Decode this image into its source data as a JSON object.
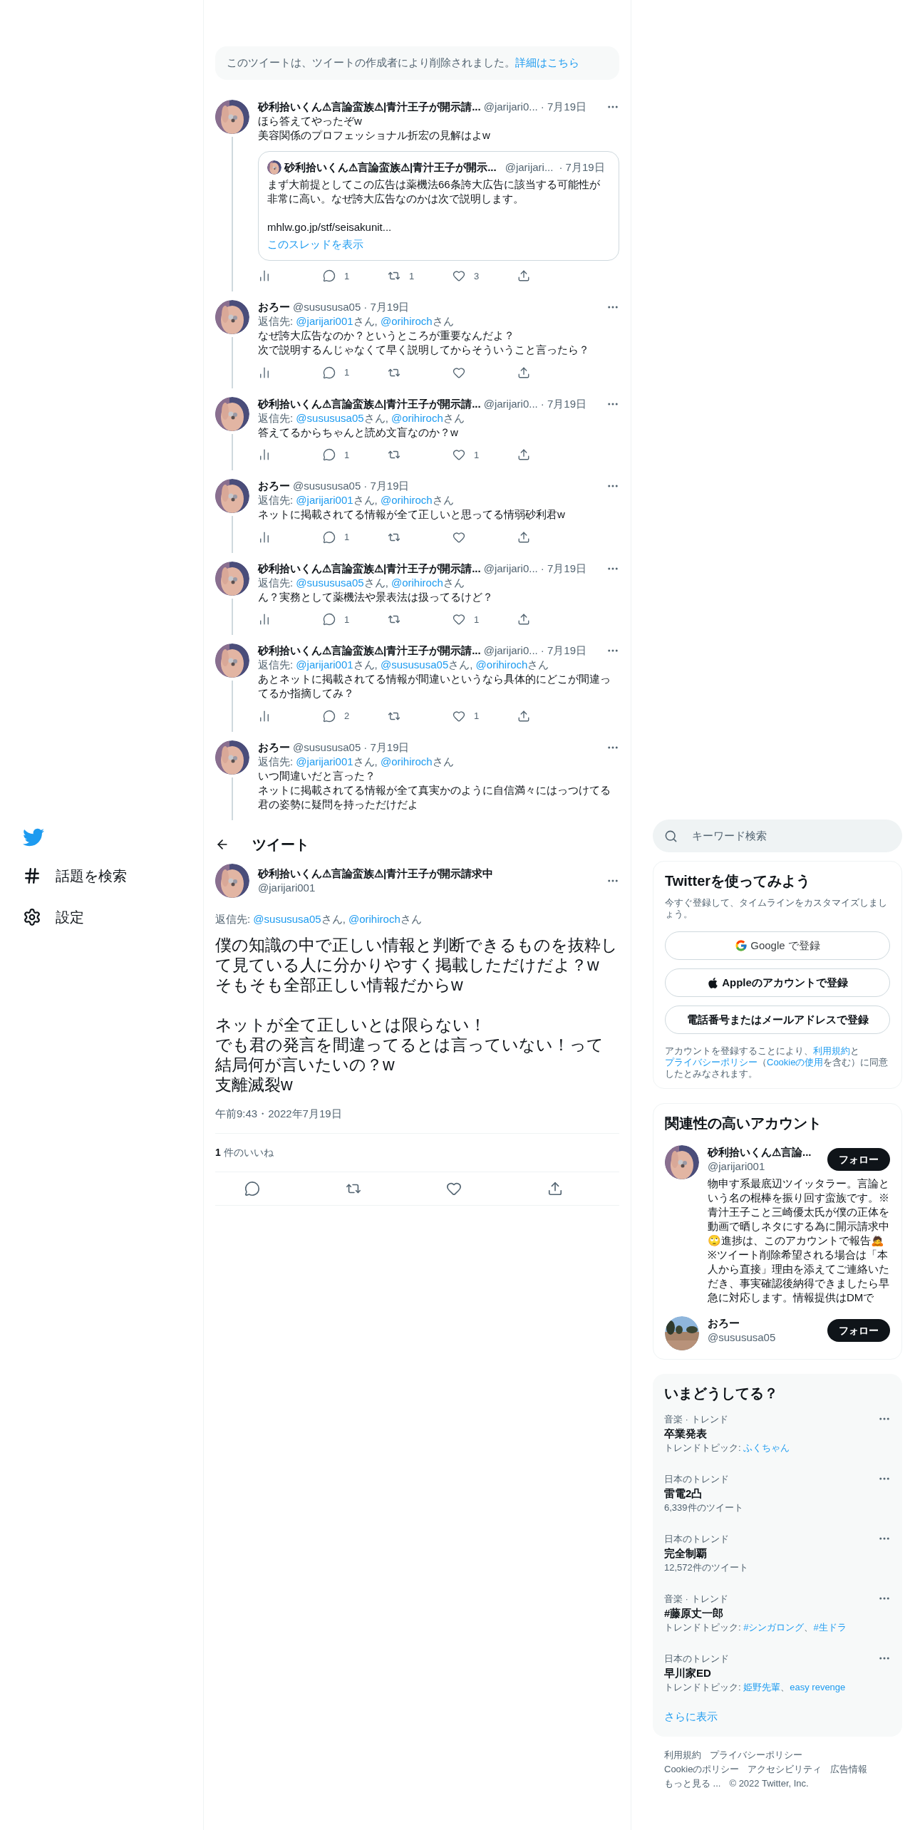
{
  "deleted_notice": {
    "text": "このツイートは、ツイートの作成者により削除されました。",
    "link": "詳細はこちら"
  },
  "thread": [
    {
      "name": "砂利拾いくん⚠言論蛮族⚠|青汁王子が開示請...",
      "handle": "@jarijari0...",
      "date": "· 7月19日",
      "lines": [
        "ほら答えてやったぞw",
        "美容関係のプロフェッショナル折宏の見解はよw"
      ],
      "quote": {
        "name": "砂利拾いくん⚠言論蛮族⚠|青汁王子が開示...",
        "handle": "@jarijari...",
        "date": "· 7月19日",
        "text": "まず大前提としてこの広告は薬機法66条誇大広告に該当する可能性が非常に高い。なぜ誇大広告なのかは次で説明します。",
        "url": "mhlw.go.jp/stf/seisakunit...",
        "thread_link": "このスレッドを表示"
      },
      "actions": [
        {
          "kind": "views"
        },
        {
          "kind": "reply",
          "count": "1"
        },
        {
          "kind": "retweet",
          "count": "1"
        },
        {
          "kind": "like",
          "count": "3"
        },
        {
          "kind": "share"
        }
      ]
    },
    {
      "name": "おろー",
      "handle": "@susususa05",
      "date": "· 7月19日",
      "reply_to": {
        "label": "返信先:",
        "separator": ", ",
        "mentions": [
          {
            "handle": "@jarijari001",
            "honorific": "さん"
          },
          {
            "handle": "@orihiroch",
            "honorific": "さん"
          }
        ]
      },
      "lines": [
        "なぜ誇大広告なのか？というところが重要なんだよ？",
        "次で説明するんじゃなくて早く説明してからそういうこと言ったら？"
      ],
      "actions": [
        {
          "kind": "views"
        },
        {
          "kind": "reply",
          "count": "1"
        },
        {
          "kind": "retweet"
        },
        {
          "kind": "like"
        },
        {
          "kind": "share"
        }
      ]
    },
    {
      "name": "砂利拾いくん⚠言論蛮族⚠|青汁王子が開示請...",
      "handle": "@jarijari0...",
      "date": "· 7月19日",
      "reply_to": {
        "label": "返信先:",
        "separator": ", ",
        "mentions": [
          {
            "handle": "@susususa05",
            "honorific": "さん"
          },
          {
            "handle": "@orihiroch",
            "honorific": "さん"
          }
        ]
      },
      "lines": [
        "答えてるからちゃんと読め文盲なのか？w"
      ],
      "actions": [
        {
          "kind": "views"
        },
        {
          "kind": "reply",
          "count": "1"
        },
        {
          "kind": "retweet"
        },
        {
          "kind": "like",
          "count": "1"
        },
        {
          "kind": "share"
        }
      ]
    },
    {
      "name": "おろー",
      "handle": "@susususa05",
      "date": "· 7月19日",
      "reply_to": {
        "label": "返信先:",
        "separator": ", ",
        "mentions": [
          {
            "handle": "@jarijari001",
            "honorific": "さん"
          },
          {
            "handle": "@orihiroch",
            "honorific": "さん"
          }
        ]
      },
      "lines": [
        "ネットに掲載されてる情報が全て正しいと思ってる情弱砂利君w"
      ],
      "actions": [
        {
          "kind": "views"
        },
        {
          "kind": "reply",
          "count": "1"
        },
        {
          "kind": "retweet"
        },
        {
          "kind": "like"
        },
        {
          "kind": "share"
        }
      ]
    },
    {
      "name": "砂利拾いくん⚠言論蛮族⚠|青汁王子が開示請...",
      "handle": "@jarijari0...",
      "date": "· 7月19日",
      "reply_to": {
        "label": "返信先:",
        "separator": ", ",
        "mentions": [
          {
            "handle": "@susususa05",
            "honorific": "さん"
          },
          {
            "handle": "@orihiroch",
            "honorific": "さん"
          }
        ]
      },
      "lines": [
        "ん？実務として薬機法や景表法は扱ってるけど？"
      ],
      "actions": [
        {
          "kind": "views"
        },
        {
          "kind": "reply",
          "count": "1"
        },
        {
          "kind": "retweet"
        },
        {
          "kind": "like",
          "count": "1"
        },
        {
          "kind": "share"
        }
      ]
    },
    {
      "name": "砂利拾いくん⚠言論蛮族⚠|青汁王子が開示請...",
      "handle": "@jarijari0...",
      "date": "· 7月19日",
      "reply_to": {
        "label": "返信先:",
        "separator": ", ",
        "mentions": [
          {
            "handle": "@jarijari001",
            "honorific": "さん"
          },
          {
            "handle": "@susususa05",
            "honorific": "さん"
          },
          {
            "handle": "@orihiroch",
            "honorific": "さん"
          }
        ]
      },
      "lines": [
        "あとネットに掲載されてる情報が間違いというなら具体的にどこが間違ってるか指摘してみ？"
      ],
      "actions": [
        {
          "kind": "views"
        },
        {
          "kind": "reply",
          "count": "2"
        },
        {
          "kind": "retweet"
        },
        {
          "kind": "like",
          "count": "1"
        },
        {
          "kind": "share"
        }
      ]
    },
    {
      "name": "おろー",
      "handle": "@susususa05",
      "date": "· 7月19日",
      "reply_to": {
        "label": "返信先:",
        "separator": ", ",
        "mentions": [
          {
            "handle": "@jarijari001",
            "honorific": "さん"
          },
          {
            "handle": "@orihiroch",
            "honorific": "さん"
          }
        ]
      },
      "lines": [
        "いつ間違いだと言った？",
        "ネットに掲載されてる情報が全て真実かのように自信満々にはっつけてる",
        "君の姿勢に疑問を持っただけだよ"
      ]
    }
  ],
  "header": {
    "title": "ツイート"
  },
  "main_tweet": {
    "name": "砂利拾いくん⚠言論蛮族⚠|青汁王子が開示請求中",
    "handle": "@jarijari001",
    "reply_to": {
      "label": "返信先:",
      "separator": ", ",
      "mentions": [
        {
          "handle": "@susususa05",
          "honorific": "さん"
        },
        {
          "handle": "@orihiroch",
          "honorific": "さん"
        }
      ]
    },
    "paragraphs": [
      [
        "僕の知識の中で正しい情報と判断できるものを抜粋して見ている人に分かりやすく掲載しただけだよ？w",
        "そもそも全部正しい情報だからw"
      ],
      [
        "ネットが全て正しいとは限らない！",
        "でも君の発言を間違ってるとは言っていない！って",
        "結局何が言いたいの？w",
        "支離滅裂w"
      ]
    ],
    "timestamp": "午前9:43・2022年7月19日",
    "likes": {
      "count": "1",
      "label": "件のいいね"
    },
    "actions": [
      {
        "kind": "reply"
      },
      {
        "kind": "retweet"
      },
      {
        "kind": "like"
      },
      {
        "kind": "share"
      }
    ]
  },
  "sidebar_nav": [
    {
      "kind": "hash",
      "label": "話題を検索"
    },
    {
      "kind": "gear",
      "label": "設定"
    }
  ],
  "search": {
    "placeholder": "キーワード検索"
  },
  "signup": {
    "title": "Twitterを使ってみよう",
    "description": "今すぐ登録して、タイムラインをカスタマイズしましょう。",
    "buttons": [
      {
        "kind": "google",
        "label": "Google で登録"
      },
      {
        "kind": "apple",
        "label": "Appleのアカウントで登録"
      },
      {
        "kind": "plain",
        "label": "電話番号またはメールアドレスで登録"
      }
    ],
    "legal": [
      {
        "text": "アカウントを登録することにより、",
        "link": false
      },
      {
        "text": "利用規約",
        "link": true
      },
      {
        "text": "と",
        "link": false
      },
      {
        "text": "プライバシーポリシー",
        "link": true
      },
      {
        "text": "（",
        "link": false
      },
      {
        "text": "Cookieの使用",
        "link": true
      },
      {
        "text": "を含む）に同意したとみなされます。",
        "link": false
      }
    ]
  },
  "related": {
    "title": "関連性の高いアカウント",
    "accounts": [
      {
        "name": "砂利拾いくん⚠言論...",
        "handle": "@jarijari001",
        "follow": "フォロー",
        "bio": "物申す系最底辺ツイッタラー。言論という名の棍棒を振り回す蛮族です。※青汁王子こと三崎優太氏が僕の正体を動画で晒しネタにする為に開示請求中🙄進捗は、このアカウントで報告🙇※ツイート削除希望される場合は「本人から直接」理由を添えてご連絡いただき、事実確認後納得できましたら早急に対応します。情報提供はDMで"
      },
      {
        "name": "おろー",
        "handle": "@susususa05",
        "follow": "フォロー"
      }
    ]
  },
  "trends": {
    "title": "いまどうしてる？",
    "items": [
      {
        "context": "音楽 · トレンド",
        "title": "卒業発表",
        "meta": "トレンドトピック:",
        "topics": [
          "ふくちゃん"
        ]
      },
      {
        "context": "日本のトレンド",
        "title": "雷電2凸",
        "meta": "6,339件のツイート"
      },
      {
        "context": "日本のトレンド",
        "title": "完全制覇",
        "meta": "12,572件のツイート"
      },
      {
        "context": "音楽 · トレンド",
        "title": "#藤原丈一郎",
        "meta": "トレンドトピック:",
        "topics": [
          "#シンガロング",
          "#生ドラ"
        ]
      },
      {
        "context": "日本のトレンド",
        "title": "早川家ED",
        "meta": "トレンドトピック:",
        "topics": [
          "姫野先輩",
          "easy revenge"
        ]
      }
    ],
    "topic_separator": "、",
    "more": "さらに表示"
  },
  "footer": [
    [
      "利用規約",
      "プライバシーポリシー"
    ],
    [
      "Cookieのポリシー",
      "アクセシビリティ",
      "広告情報"
    ],
    [
      "もっと見る ...",
      "© 2022 Twitter, Inc."
    ]
  ]
}
